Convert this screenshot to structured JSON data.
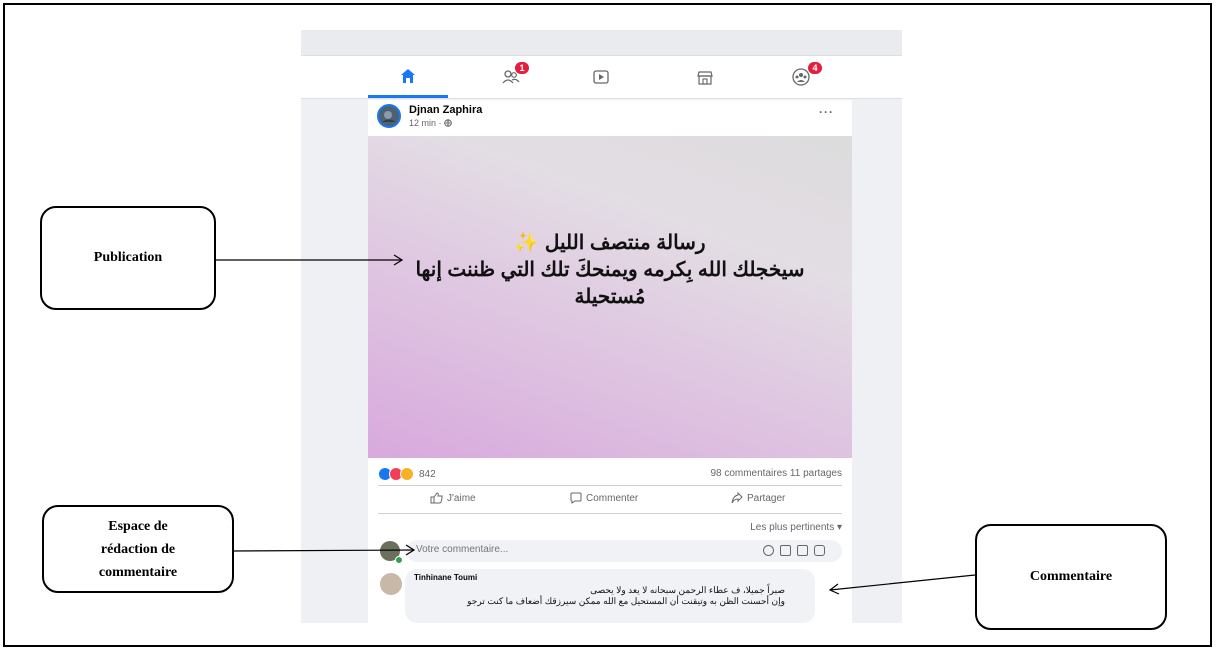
{
  "author": {
    "name": "Djnan Zaphira",
    "time": "12 min ·"
  },
  "nav": {
    "friends_badge": "1",
    "groups_badge": "4"
  },
  "post": {
    "line1": "رسالة منتصف الليل ✨",
    "line2": "سيخجلك الله بِكرمه ويمنحكَ تلك التي ظننت إنها",
    "line3": "مُستحيلة"
  },
  "stats": {
    "reaction_count": "842",
    "comments_shares": "98 commentaires 11 partages"
  },
  "actions": {
    "like": "J'aime",
    "comment": "Commenter",
    "share": "Partager"
  },
  "sort_label": "Les plus pertinents ▾",
  "comment_input": {
    "placeholder": "Votre commentaire..."
  },
  "comment": {
    "name": "Tinhinane Toumi",
    "line1": "صبراً جميلا، ف عطاء الرحمن سبحانه لا يعد ولا يحصى",
    "line2": "وإن أحسنت الظن به وتيقنت أن المستحيل مع الله ممكن سيرزقك أضعاف ما كنت ترجو"
  },
  "callouts": {
    "publication": "Publication",
    "espace_line1": "Espace de",
    "espace_line2": "rédaction de",
    "espace_line3": "commentaire",
    "commentaire": "Commentaire"
  },
  "colors": {
    "accent": "#1877f2",
    "badge": "#e41e3f"
  }
}
